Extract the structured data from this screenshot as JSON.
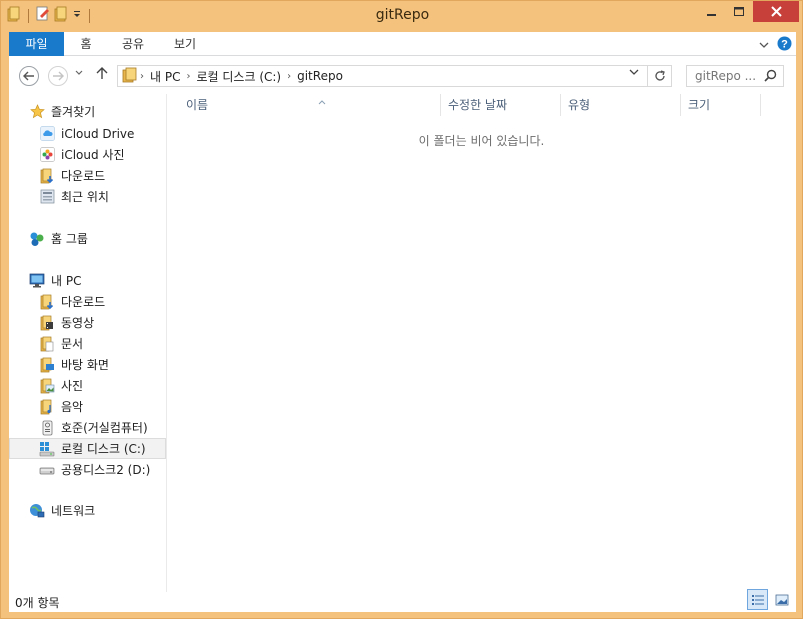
{
  "window": {
    "title": "gitRepo"
  },
  "ribbon": {
    "tabs": [
      "파일",
      "홈",
      "공유",
      "보기"
    ]
  },
  "address": {
    "crumbs": [
      "내 PC",
      "로컬 디스크 (C:)",
      "gitRepo"
    ],
    "search_placeholder": "gitRepo ..."
  },
  "navpane": {
    "favorites_label": "즐겨찾기",
    "favorites": [
      "iCloud Drive",
      "iCloud 사진",
      "다운로드",
      "최근 위치"
    ],
    "homegroup_label": "홈 그룹",
    "thispc_label": "내 PC",
    "thispc_items": [
      "다운로드",
      "동영상",
      "문서",
      "바탕 화면",
      "사진",
      "음악",
      "호준(거실컴퓨터)",
      "로컬 디스크 (C:)",
      "공용디스크2 (D:)"
    ],
    "network_label": "네트워크"
  },
  "content": {
    "columns": [
      "이름",
      "수정한 날짜",
      "유형",
      "크기"
    ],
    "empty_message": "이 폴더는 비어 있습니다."
  },
  "status": {
    "item_count": "0개 항목"
  },
  "colors": {
    "frame": "#f4c27c",
    "file_tab": "#1979ca",
    "close_button": "#c7413a",
    "header_text": "#4c607a"
  }
}
